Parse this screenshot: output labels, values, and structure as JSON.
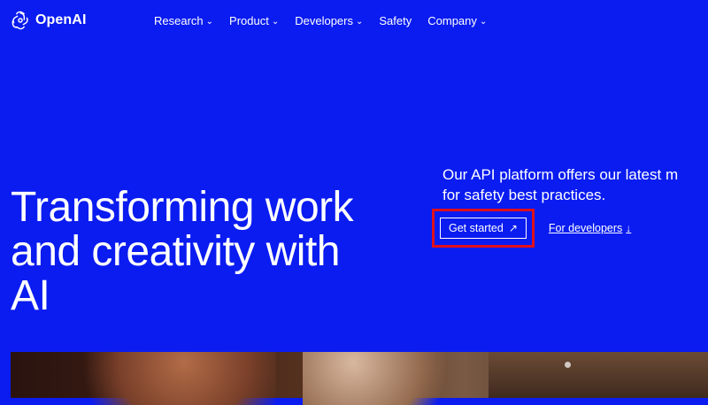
{
  "nav": {
    "logo_text": "OpenAI",
    "items": [
      {
        "label": "Research",
        "has_dropdown": true
      },
      {
        "label": "Product",
        "has_dropdown": true
      },
      {
        "label": "Developers",
        "has_dropdown": true
      },
      {
        "label": "Safety",
        "has_dropdown": false
      },
      {
        "label": "Company",
        "has_dropdown": true
      }
    ]
  },
  "hero": {
    "title_line1": "Transforming work",
    "title_line2": "and creativity with",
    "title_line3": "AI",
    "desc_line1": "Our API platform offers our latest m",
    "desc_line2": "for safety best practices.",
    "primary_cta": "Get started",
    "secondary_cta": "For developers"
  },
  "icons": {
    "logo": "openai-logo-icon",
    "dropdown": "chevron-down-icon",
    "external": "arrow-up-right-icon",
    "down": "arrow-down-icon"
  },
  "colors": {
    "background": "#0a1cf0",
    "text": "#ffffff",
    "highlight": "#e10f1b"
  }
}
